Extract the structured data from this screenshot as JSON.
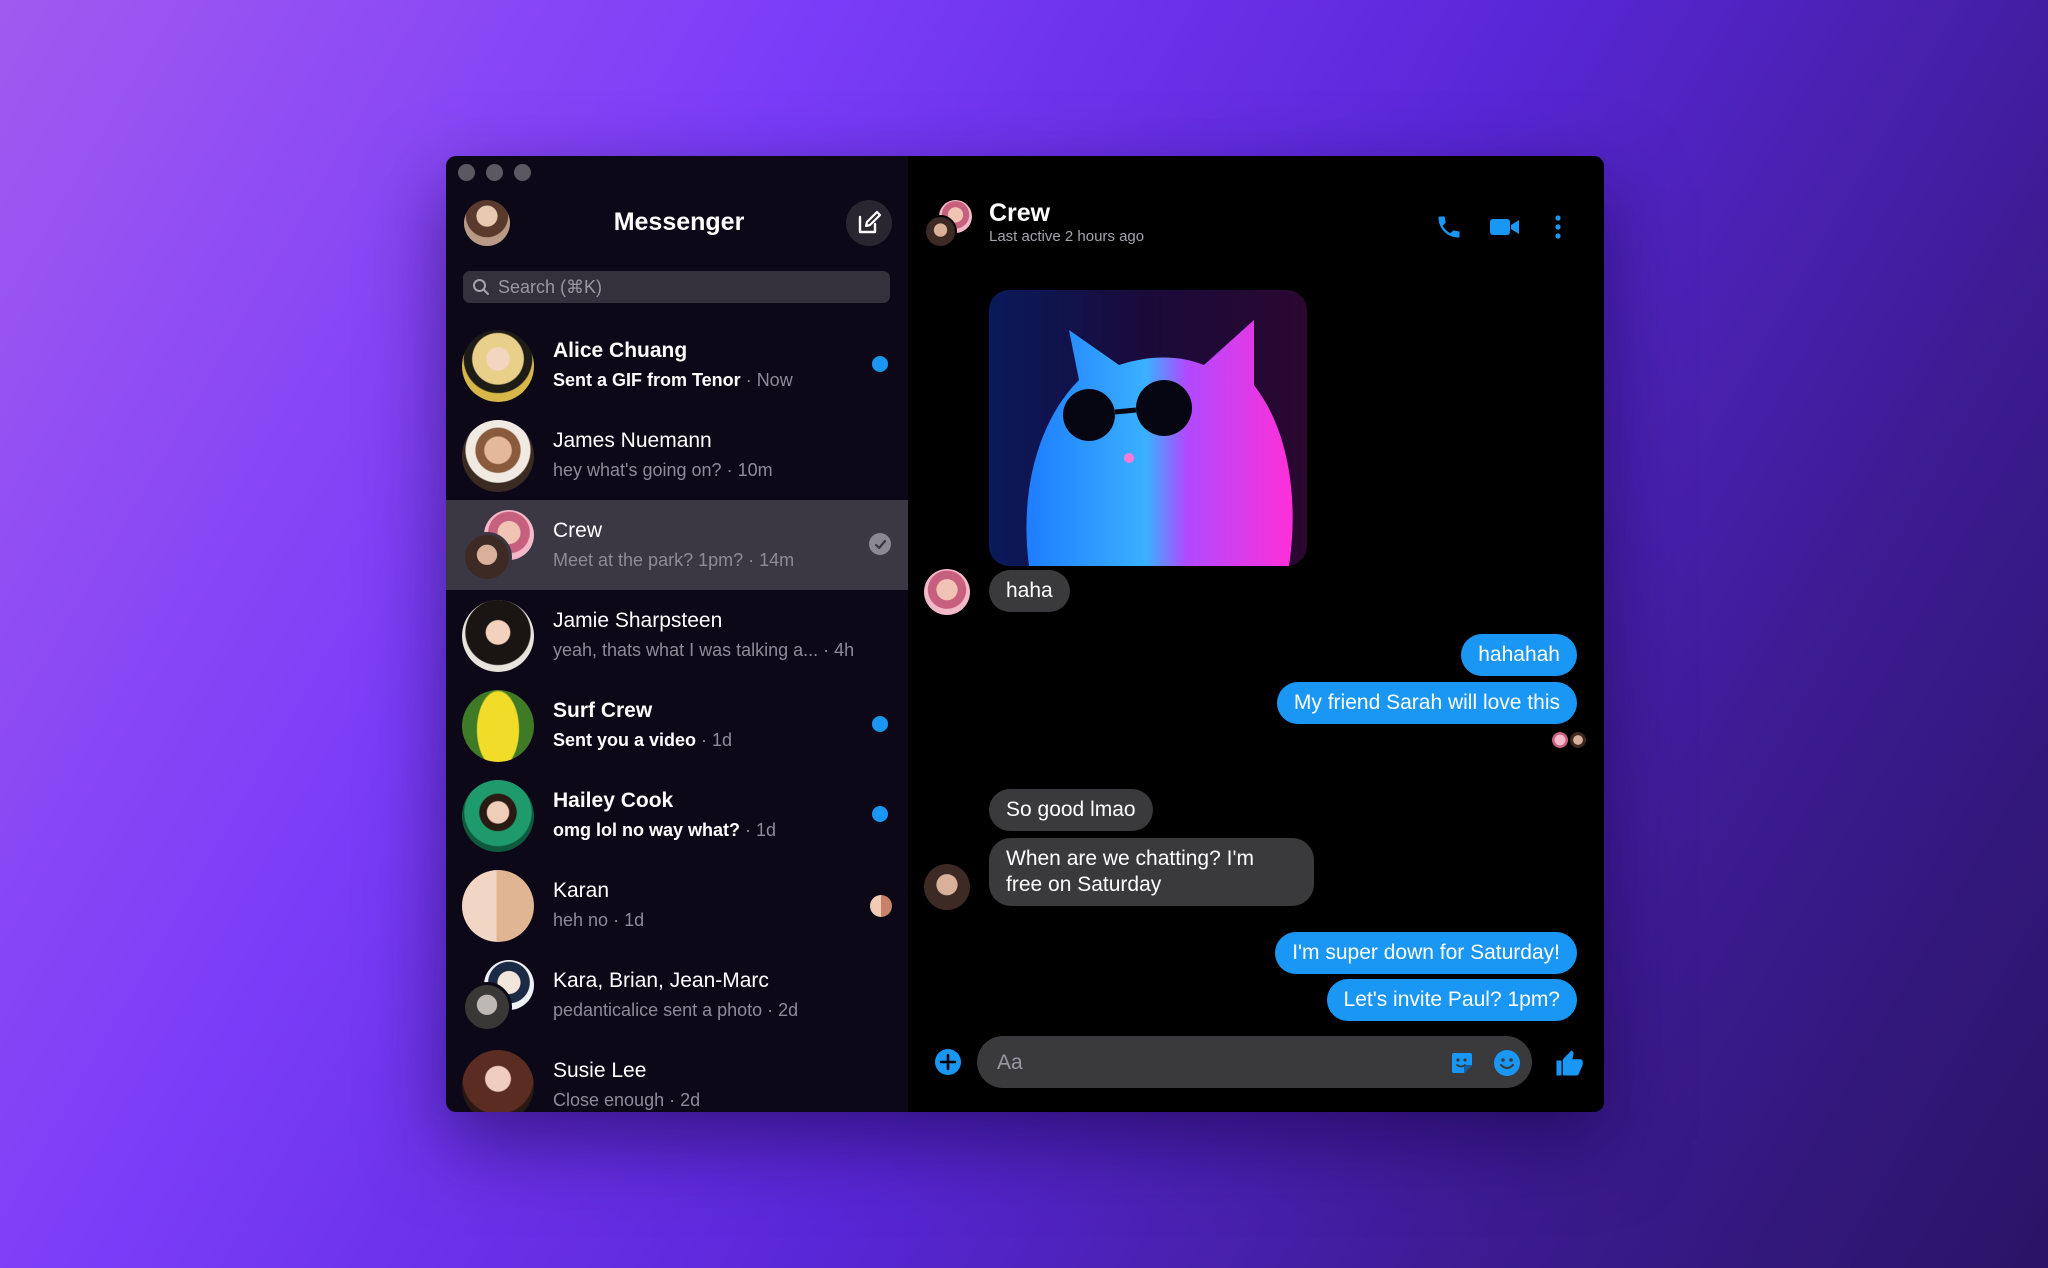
{
  "app": {
    "title": "Messenger",
    "search_placeholder": "Search (⌘K)",
    "accent_color": "#1a97f5"
  },
  "conversations": [
    {
      "name": "Alice Chuang",
      "snippet": "Sent a GIF from Tenor",
      "time": "Now",
      "unread": true,
      "status": "unread-dot"
    },
    {
      "name": "James Nuemann",
      "snippet": "hey what's going on?",
      "time": "10m",
      "unread": false,
      "status": ""
    },
    {
      "name": "Crew",
      "snippet": "Meet at the park? 1pm?",
      "time": "14m",
      "unread": false,
      "status": "sent-check",
      "active": true
    },
    {
      "name": "Jamie Sharpsteen",
      "snippet": "yeah, thats what I was talking a...",
      "time": "4h",
      "unread": false,
      "status": ""
    },
    {
      "name": "Surf Crew",
      "snippet": "Sent you a video",
      "time": "1d",
      "unread": true,
      "status": "unread-dot"
    },
    {
      "name": "Hailey Cook",
      "snippet": "omg lol no way what?",
      "time": "1d",
      "unread": true,
      "status": "unread-dot"
    },
    {
      "name": "Karan",
      "snippet": "heh no",
      "time": "1d",
      "unread": false,
      "status": "seen-avatar"
    },
    {
      "name": "Kara, Brian, Jean-Marc",
      "snippet": "pedanticalice sent a photo",
      "time": "2d",
      "unread": false,
      "status": ""
    },
    {
      "name": "Susie Lee",
      "snippet": "Close enough",
      "time": "2d",
      "unread": false,
      "status": ""
    }
  ],
  "chat": {
    "title": "Crew",
    "subtitle": "Last active 2 hours ago",
    "messages": [
      {
        "from": "them",
        "type": "photo",
        "description": "cat with sunglasses"
      },
      {
        "from": "them",
        "text": "haha"
      },
      {
        "from": "me",
        "text": "hahahah"
      },
      {
        "from": "me",
        "text": "My friend Sarah will love this"
      },
      {
        "from": "them",
        "text": "So good lmao"
      },
      {
        "from": "them",
        "text_lines": [
          "When are we chatting? I'm",
          "free on Saturday"
        ]
      },
      {
        "from": "me",
        "text": "I'm super down for Saturday!"
      },
      {
        "from": "me",
        "text": "Let's invite Paul? 1pm?"
      }
    ],
    "composer_placeholder": "Aa"
  },
  "icons": {
    "compose": "compose-icon",
    "search": "search-icon",
    "call": "phone-icon",
    "video": "video-camera-icon",
    "more": "more-vertical-icon",
    "add": "plus-circle-icon",
    "sticker": "sticker-icon",
    "emoji": "emoji-icon",
    "like": "thumbs-up-icon"
  }
}
